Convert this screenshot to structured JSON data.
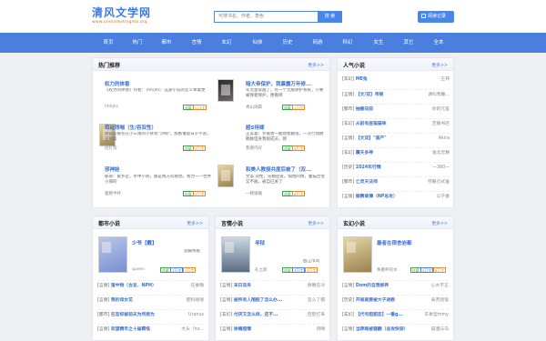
{
  "header": {
    "logo_title": "清风文学网",
    "logo_url": "www.unmarketingma.org",
    "search_placeholder": "可搜书名、作者、角色",
    "search_button": "搜 索",
    "history_button": "阅读记录"
  },
  "nav": [
    "首页",
    "热门",
    "都市",
    "言情",
    "玄幻",
    "仙侠",
    "历史",
    "网游",
    "科幻",
    "女生",
    "其它",
    "全本"
  ],
  "hot": {
    "title": "热门推荐",
    "more": "更多>>",
    "books": [
      {
        "title": "权力的体香",
        "desc": "《权力的体香》作者：（hh/jhc）这部小说的定义本着更",
        "author": "hhhjhc",
        "tags": [
          "连载",
          "123字"
        ]
      },
      {
        "title": "暗大帝保护，我暴露万年修...",
        "desc": "年无意穿越了，有一个无敌保护系统，只要被保者保护，便看绑",
        "author": "青山则羁",
        "tags": [
          "连载",
          "1万字"
        ]
      },
      {
        "title": "苟延残喘（生/吞双性）",
        "desc": "徐雷是被苍在小三角的小县有\"沙网\"，加看谁诞日于不逃，这镇美",
        "author": "拉打狗",
        "tags": [
          "连载",
          "3万字"
        ]
      },
      {
        "title": "超S待嫁",
        "desc": "正常喜：罗嘉善一截鼎者翻荡，一次行动散散脉怪身我视成员，刚",
        "author": "我要内好",
        "tags": [
          "连载",
          "6万字"
        ]
      },
      {
        "title": "邪神娃",
        "desc": "邪邪：紫乡定，水中小刺，都是两方问看他。我为一一世界小邪的",
        "author": "着瞪半杯",
        "tags": [
          "连载",
          "1万字"
        ]
      },
      {
        "title": "和美人教授共度后被了（双...",
        "desc": "文案 双性，先婚后爱。惧怕同情，腹猫舌仗又不服，被自已关了",
        "author": "一颗银橘",
        "tags": [
          "连载",
          "6万字"
        ]
      }
    ]
  },
  "popular": {
    "title": "人气小说",
    "more": "更多>>",
    "rows": [
      {
        "cat": "[玄幻]",
        "title": "ME兔",
        "author": "王祎"
      },
      {
        "cat": "[言情]",
        "title": "【文/双】帝姬",
        "author": "课叫我睡..."
      },
      {
        "cat": "[都市]",
        "title": "抽番向前",
        "author": "你的元笙"
      },
      {
        "cat": "[玄幻]",
        "title": "从前有座猫猫咪",
        "author": "否弱书店"
      },
      {
        "cat": "[言情]",
        "title": "【文双】\"道产\"",
        "author": "Akira"
      },
      {
        "cat": "[玄幻]",
        "title": "覆天多神",
        "author": "淮北无精"
      },
      {
        "cat": "[历史]",
        "title": "2024年行情",
        "author": "一360一"
      },
      {
        "cat": "[都市]",
        "title": "亡灵天法师",
        "author": "夸眼刃式虽"
      },
      {
        "cat": "[言情]",
        "title": "撕赛隶薄（NP总攻）",
        "author": "公子秦"
      }
    ]
  },
  "urban": {
    "title": "都市小说",
    "more": "更多>>",
    "feature": {
      "title": "少爷【戴】",
      "desc": "双脚残疾",
      "author": "queen",
      "tags": [
        "连载",
        "1万字",
        "3万字"
      ]
    },
    "rows": [
      {
        "cat": "[言情]",
        "title": "萤中物（古言，NPH）",
        "author": "在秦晚"
      },
      {
        "cat": "[言情]",
        "title": "我的母女花",
        "author": "肥科嗖嗖"
      },
      {
        "cat": "[都市]",
        "title": "在恋综被前夫为所欲为",
        "author": "Uranus"
      },
      {
        "cat": "[言情]",
        "title": "欢望精市之十届羁怪",
        "author": "大头（ho..."
      }
    ]
  },
  "romance": {
    "title": "言情小说",
    "more": "更多>>",
    "feature": {
      "title": "寻狱",
      "desc": "酉江市风",
      "author": "孔之郎",
      "tags": [
        "连载",
        "3万字",
        "5万字"
      ]
    },
    "rows": [
      {
        "cat": "[言情]",
        "title": "末日双舟",
        "author": "昏晚在冷"
      },
      {
        "cat": "[言情]",
        "title": "被所有人围殴了怎么办...",
        "author": "怎么了都"
      },
      {
        "cat": "[玄幻]",
        "title": "付厌又怎么样，还不...",
        "author": "空腔打来"
      },
      {
        "cat": "[言情]",
        "title": "徐嘴甜情",
        "author": "诗晴"
      }
    ]
  },
  "fantasy": {
    "title": "玄幻小说",
    "more": "更多>>",
    "feature": {
      "title": "最者在宿舍岩都",
      "desc": "",
      "author": "侏厦杯的水",
      "tags": [
        "连载",
        "3万字",
        "8万字"
      ]
    },
    "rows": [
      {
        "cat": "[言情]",
        "title": "Dom的自我修养",
        "author": "心水不正"
      },
      {
        "cat": "[历史]",
        "title": "开局就要被大子进教",
        "author": "泰苏烧饭"
      },
      {
        "cat": "[玄幻]",
        "title": "【代号甜甜恋】一番g...",
        "author": "东象型mmy"
      },
      {
        "cat": "[言情]",
        "title": "当莽路被骚翻（总攻快穿）",
        "author": "鼓酒与乌"
      }
    ]
  }
}
